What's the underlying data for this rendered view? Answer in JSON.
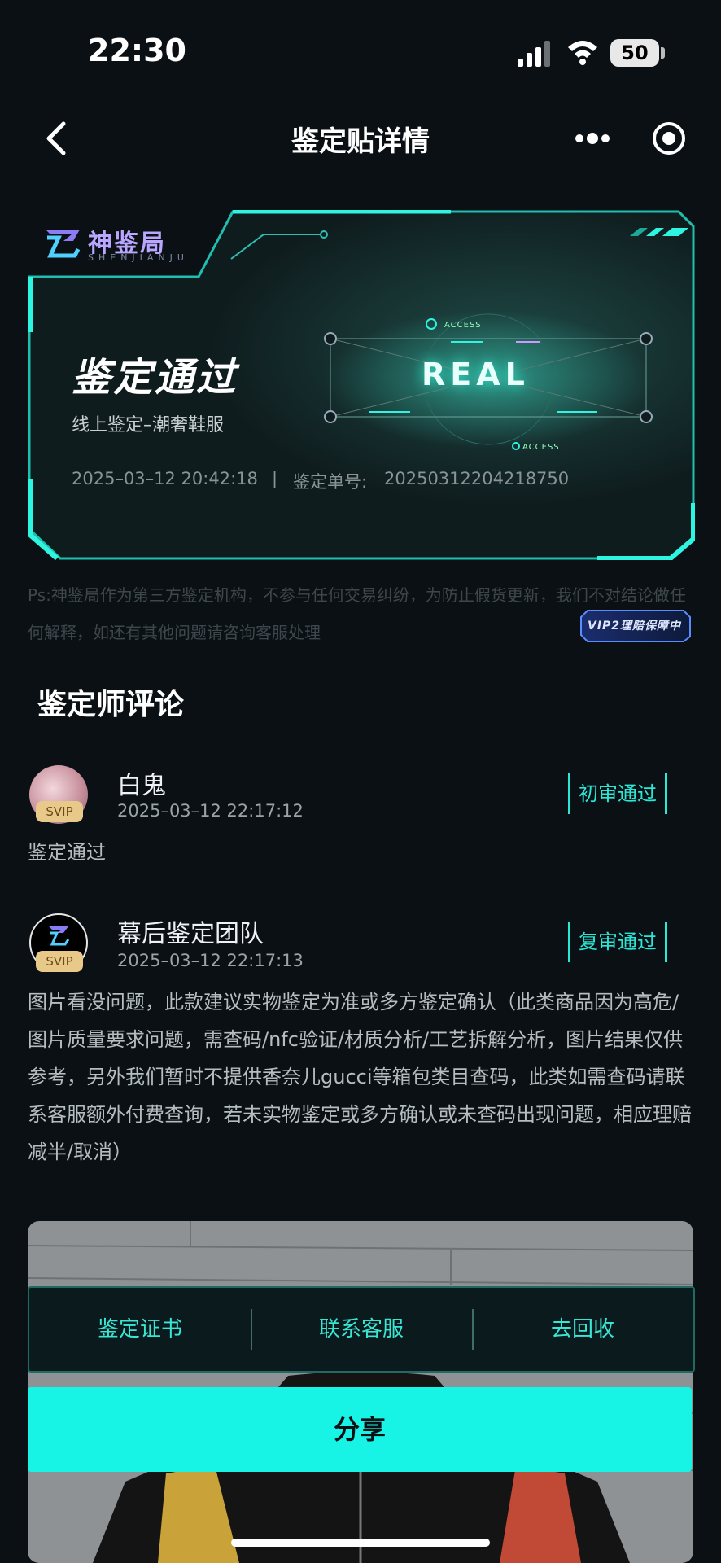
{
  "status_bar": {
    "time": "22:30",
    "battery": "50"
  },
  "nav": {
    "title": "鉴定贴详情"
  },
  "certificate": {
    "brand": "神鉴局",
    "brand_sub": "SHENJIANJU",
    "status": "鉴定通过",
    "category": "线上鉴定–潮奢鞋服",
    "date": "2025–03–12 20:42:18",
    "separator": "|",
    "order_label": "鉴定单号:",
    "order_no": "20250312204218750",
    "stamp": "REAL",
    "access_label": "ACCESS"
  },
  "disclaimer": "Ps:神鉴局作为第三方鉴定机构，不参与任何交易纠纷，为防止假货更新，我们不对结论做任何解释，如还有其他问题请咨询客服处理",
  "vip_badge": "VIP2理赔保障中",
  "comments_section": {
    "title": "鉴定师评论",
    "comments": [
      {
        "name": "白鬼",
        "level": "SVIP",
        "time": "2025–03–12 22:17:12",
        "badge": "初审通过",
        "text": "鉴定通过"
      },
      {
        "name": "幕后鉴定团队",
        "level": "SVIP",
        "time": "2025–03–12 22:17:13",
        "badge": "复审通过",
        "text": "图片看没问题，此款建议实物鉴定为准或多方鉴定确认（此类商品因为高危/图片质量要求问题，需查码/nfc验证/材质分析/工艺拆解分析，图片结果仅供参考，另外我们暂时不提供香奈儿gucci等箱包类目查码，此类如需查码请联系客服额外付费查询，若未实物鉴定或多方确认或未查码出现问题，相应理赔减半/取消）"
      }
    ]
  },
  "actions": {
    "certificate": "鉴定证书",
    "contact": "联系客服",
    "recycle": "去回收",
    "share": "分享"
  },
  "colors": {
    "accent": "#17f3e5",
    "background": "#0b1015",
    "badge": "#29e8d6"
  }
}
